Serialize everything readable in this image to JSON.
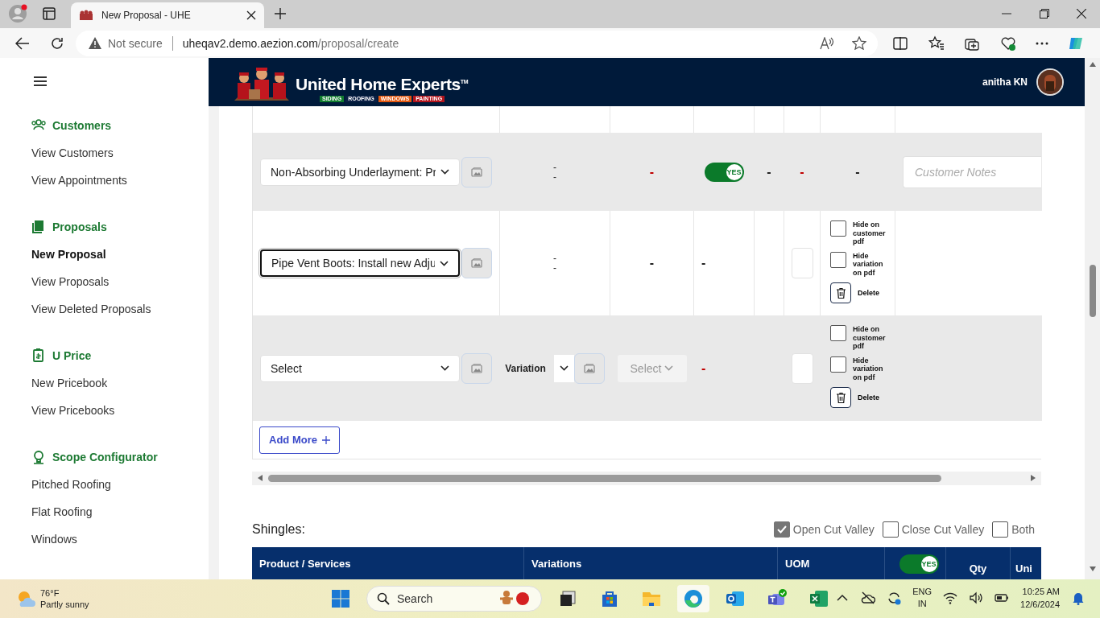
{
  "browser": {
    "tab_title": "New Proposal - UHE",
    "security_label": "Not secure",
    "url_host": "uheqav2.demo.aezion.com",
    "url_path": "/proposal/create"
  },
  "sidebar": {
    "sections": [
      {
        "title": "Customers",
        "items": [
          {
            "label": "View Customers",
            "selected": false
          },
          {
            "label": "View Appointments",
            "selected": false
          }
        ]
      },
      {
        "title": "Proposals",
        "items": [
          {
            "label": "New Proposal",
            "selected": true
          },
          {
            "label": "View Proposals",
            "selected": false
          },
          {
            "label": "View Deleted Proposals",
            "selected": false
          }
        ]
      },
      {
        "title": "U Price",
        "items": [
          {
            "label": "New Pricebook",
            "selected": false
          },
          {
            "label": "View Pricebooks",
            "selected": false
          }
        ]
      },
      {
        "title": "Scope Configurator",
        "items": [
          {
            "label": "Pitched Roofing",
            "selected": false
          },
          {
            "label": "Flat Roofing",
            "selected": false
          },
          {
            "label": "Windows",
            "selected": false
          }
        ]
      }
    ]
  },
  "header": {
    "brand": "United Home Experts",
    "brand_mark": "TM",
    "services": [
      {
        "label": "SIDING",
        "color": "#107c2e"
      },
      {
        "label": "ROOFING",
        "color": "#0a1f44"
      },
      {
        "label": "WINDOWS",
        "color": "#e2570f"
      },
      {
        "label": "PAINTING",
        "color": "#b3141c"
      }
    ],
    "user": "anitha KN"
  },
  "table": {
    "rows": [
      {
        "kind": "partial"
      },
      {
        "kind": "item",
        "product": {
          "value": "Non-Absorbing Underlayment: Pr",
          "focused": false
        },
        "cells": [
          {
            "kind": "stack",
            "lines": [
              "-",
              "-"
            ]
          },
          {
            "kind": "text",
            "text": "-",
            "color": "#c00000"
          },
          {
            "kind": "toggle",
            "label": "YES",
            "on": true
          },
          {
            "kind": "text",
            "text": "-",
            "color": "#222222"
          },
          {
            "kind": "text",
            "text": "-",
            "color": "#c00000"
          },
          {
            "kind": "text",
            "text": "-",
            "color": "#222222"
          },
          {
            "kind": "notes",
            "placeholder": "Customer Notes"
          }
        ]
      },
      {
        "kind": "item",
        "product": {
          "value": "Pipe Vent Boots: Install new Adju",
          "focused": true
        },
        "cells": [
          {
            "kind": "stack",
            "lines": [
              "-",
              "-"
            ]
          },
          {
            "kind": "text",
            "text": "-",
            "color": "#222222"
          },
          {
            "kind": "text",
            "text": "-",
            "color": "#222222"
          },
          {
            "kind": "empty"
          },
          {
            "kind": "qty"
          },
          {
            "kind": "options",
            "checks": [
              {
                "label": "Hide on customer pdf",
                "checked": false
              },
              {
                "label": "Hide variation on pdf",
                "checked": false
              }
            ],
            "delete": "Delete"
          },
          {
            "kind": "blank"
          }
        ]
      },
      {
        "kind": "item",
        "product": {
          "value": "Select",
          "focused": false
        },
        "cells": [
          {
            "kind": "variation",
            "label": "Variation"
          },
          {
            "kind": "select",
            "value": "Select",
            "disabled": true
          },
          {
            "kind": "text",
            "text": "-",
            "color": "#c00000"
          },
          {
            "kind": "empty"
          },
          {
            "kind": "qty"
          },
          {
            "kind": "options",
            "checks": [
              {
                "label": "Hide on customer pdf",
                "checked": false
              },
              {
                "label": "Hide variation on pdf",
                "checked": false
              }
            ],
            "delete": "Delete"
          },
          {
            "kind": "blank"
          }
        ]
      }
    ],
    "add_more": "Add More"
  },
  "shingles": {
    "title": "Shingles:",
    "options": [
      {
        "label": "Open Cut Valley",
        "checked": true
      },
      {
        "label": "Close Cut Valley",
        "checked": false
      },
      {
        "label": "Both",
        "checked": false
      }
    ],
    "columns": [
      {
        "kind": "text",
        "label": "Product / Services"
      },
      {
        "kind": "text",
        "label": "Variations"
      },
      {
        "kind": "text",
        "label": "UOM"
      },
      {
        "kind": "toggle",
        "label": "YES",
        "on": true
      },
      {
        "kind": "text",
        "label": "Qty"
      },
      {
        "kind": "text",
        "label": "Uni"
      }
    ]
  },
  "taskbar": {
    "weather": {
      "temp": "76°F",
      "condition": "Partly sunny"
    },
    "search": "Search",
    "language": [
      "ENG",
      "IN"
    ],
    "time": "10:25 AM",
    "date": "12/6/2024"
  }
}
